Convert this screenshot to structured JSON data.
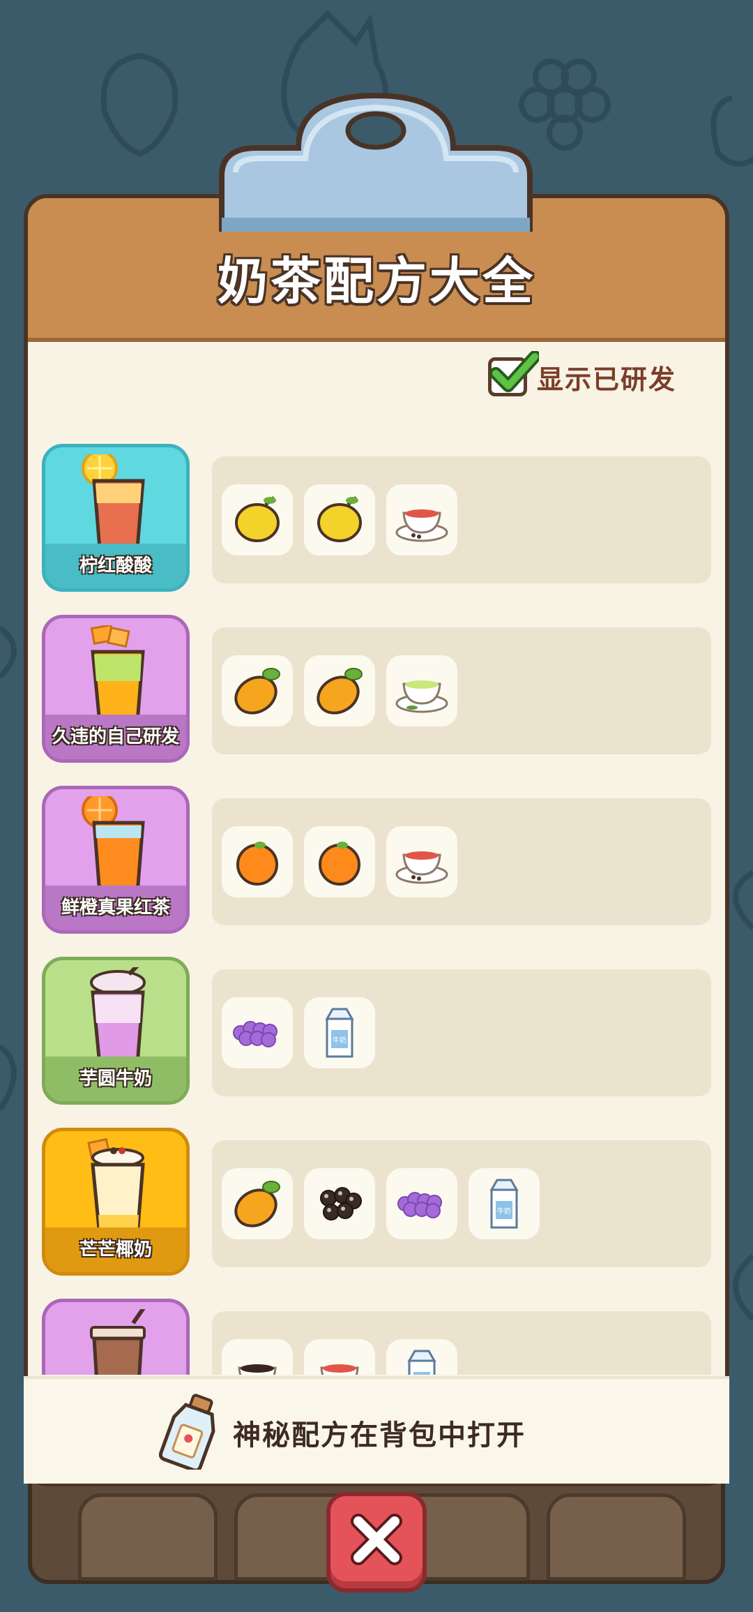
{
  "title": "奶茶配方大全",
  "toggle": {
    "label": "显示已研发",
    "checked": true
  },
  "recipes": [
    {
      "name": "柠红酸酸",
      "theme": "cyan",
      "ingredients": [
        "lemon-icon",
        "lemon-icon",
        "red-tea-icon"
      ]
    },
    {
      "name": "久违的自己研发",
      "theme": "purple",
      "ingredients": [
        "mango-icon",
        "mango-icon",
        "green-tea-icon"
      ]
    },
    {
      "name": "鲜橙真果红茶",
      "theme": "purple",
      "ingredients": [
        "orange-icon",
        "orange-icon",
        "red-tea-icon"
      ]
    },
    {
      "name": "芋圆牛奶",
      "theme": "green",
      "ingredients": [
        "taro-ball-icon",
        "milk-carton-icon"
      ]
    },
    {
      "name": "芒芒椰奶",
      "theme": "gold",
      "ingredients": [
        "mango-icon",
        "tapioca-pearl-icon",
        "taro-ball-icon",
        "milk-carton-icon"
      ]
    },
    {
      "name": "",
      "theme": "purple",
      "ingredients": [
        "coffee-icon",
        "red-tea-icon",
        "milk-carton-icon"
      ]
    }
  ],
  "footer": {
    "text": "神秘配方在背包中打开"
  },
  "colors": {
    "background": "#3b5b6b",
    "board": "#f8f3e5",
    "header": "#c98d51",
    "close": "#e4535a"
  }
}
